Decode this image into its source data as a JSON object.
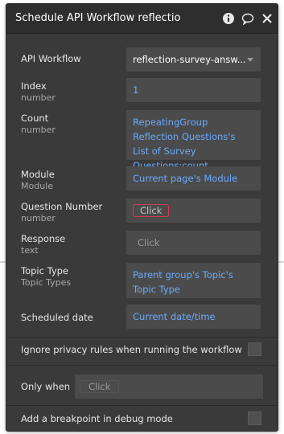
{
  "header": {
    "title": "Schedule API Workflow reflectio",
    "icons": [
      "info-icon",
      "comment-icon",
      "close-icon"
    ]
  },
  "fields": {
    "api_workflow": {
      "label": "API Workflow",
      "value": "reflection-survey-answ..."
    },
    "index": {
      "label": "Index",
      "type": "number",
      "value": "1"
    },
    "count": {
      "label": "Count",
      "type": "number",
      "value": "RepeatingGroup Reflection Questions's List of Survey Questions:count"
    },
    "module": {
      "label": "Module",
      "type": "Module",
      "value": "Current page's Module"
    },
    "question_number": {
      "label": "Question Number",
      "type": "number",
      "value": "Click"
    },
    "response": {
      "label": "Response",
      "type": "text",
      "placeholder": "Click"
    },
    "topic_type": {
      "label": "Topic Type",
      "type": "Topic Types",
      "value": "Parent group's Topic's Topic Type"
    },
    "scheduled_date": {
      "label": "Scheduled date",
      "value": "Current date/time"
    }
  },
  "options": {
    "ignore_privacy": {
      "label": "Ignore privacy rules when running the workflow",
      "checked": false
    },
    "only_when": {
      "label": "Only when",
      "placeholder": "Click"
    },
    "breakpoint": {
      "label": "Add a breakpoint in debug mode",
      "checked": false
    }
  },
  "colors": {
    "panel": "#3a3a3a",
    "header": "#2e2e2e",
    "field": "#4b4b4b",
    "link": "#6aaaff",
    "pill_border": "#d23a5a"
  }
}
